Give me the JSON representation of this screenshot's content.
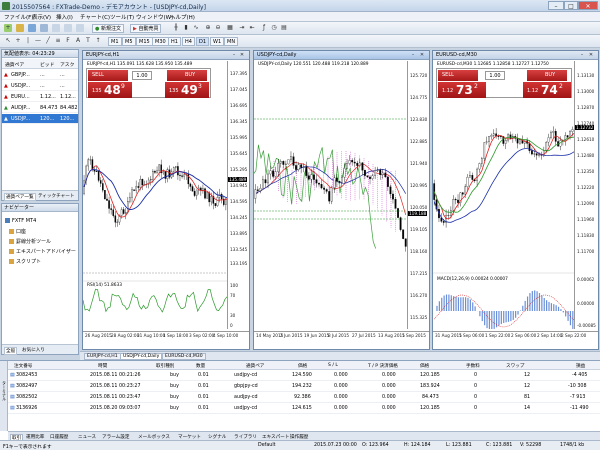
{
  "app": {
    "title": "2015507564 : FXTrade-Demo - デモアカウント - [USDJPY-cd,Daily]"
  },
  "window_controls": {
    "minimize": "–",
    "maximize": "□",
    "close": "✕"
  },
  "menu": [
    "ファイル(F)",
    "表示(V)",
    "挿入(I)",
    "チャート(C)",
    "ツール(T)",
    "ウィンドウ(W)",
    "ヘルプ(H)"
  ],
  "toolbar": {
    "new_order": "新規注文",
    "auto_trade": "自動売買",
    "periods": [
      "M1",
      "M5",
      "M15",
      "M30",
      "H1",
      "H4",
      "D1",
      "W1",
      "MN"
    ]
  },
  "market_watch": {
    "title": "気配値表示: 04:23:29",
    "headers": [
      "通貨ペア",
      "ビッド",
      "アスク"
    ],
    "rows": [
      {
        "symbol": "GBPJP...",
        "bid": "...",
        "ask": "..."
      },
      {
        "symbol": "USDJP...",
        "bid": "...",
        "ask": "..."
      },
      {
        "symbol": "EURU...",
        "bid": "1.12...",
        "ask": "1.12..."
      },
      {
        "symbol": "AUDJP...",
        "bid": "84.473",
        "ask": "84.482"
      },
      {
        "symbol": "USDJP...",
        "bid": "120...",
        "ask": "120..."
      }
    ],
    "tabs": [
      "通貨ペア一覧",
      "ティックチャート"
    ]
  },
  "navigator": {
    "title": "ナビゲーター",
    "items": [
      "FXTF MT4",
      "口座",
      "罫線分析ツール",
      "エキスパートアドバイザー",
      "スクリプト"
    ],
    "tabs": [
      "全般",
      "お気に入り"
    ]
  },
  "charts": [
    {
      "window_title": "EURJPY-cd,H1",
      "info": "EURJPY-cd,H1  135.091 135.628 135.950 135.489",
      "sell_label": "SELL",
      "buy_label": "BUY",
      "lot": "1.00",
      "sell_price": {
        "pre": "135",
        "big": "48",
        "sup": "9"
      },
      "buy_price": {
        "pre": "135",
        "big": "49",
        "sup": "3"
      },
      "price_axis": [
        "137.395",
        "137.045",
        "136.695",
        "136.345",
        "135.995",
        "135.645",
        "135.295",
        "134.945",
        "134.595",
        "134.245",
        "133.895",
        "133.545",
        "133.195"
      ],
      "current_price": "135.489",
      "indicator": "RSI(14) 51.8633",
      "indicator_axis": [
        "100",
        "70",
        "30",
        "0"
      ],
      "dates": [
        "26 Aug 2015",
        "27 Aug 10:00",
        "28 Aug 02:00",
        "28 Aug 18:00",
        "31 Aug 10:00",
        "1 Sep 02:00",
        "1 Sep 18:00",
        "2 Sep 10:00",
        "3 Sep 02:00",
        "3 Sep 18:00",
        "4 Sep 10:00"
      ]
    },
    {
      "window_title": "USDJPY-cd,Daily",
      "info": "USDJPY-cd,Daily  120.551 120.488 119.218 120.889",
      "price_axis": [
        "125.720",
        "124.775",
        "123.830",
        "122.885",
        "121.940",
        "120.995",
        "120.050",
        "119.105",
        "118.160",
        "117.215",
        "116.270",
        "115.325"
      ],
      "current_price": "119.188",
      "dates": [
        "14 May 2015",
        "2 Jun 2015",
        "19 Jun 2015",
        "8 Jul 2015",
        "27 Jul 2015",
        "13 Aug 2015",
        "1 Sep 2015"
      ]
    },
    {
      "window_title": "EURUSD-cd,M30",
      "info": "EURUSD-cd,M30  1.12685 1.12858 1.12727 1.12750",
      "sell_label": "SELL",
      "buy_label": "BUY",
      "lot": "1.00",
      "sell_price": {
        "pre": "1.12",
        "big": "73",
        "sup": "2"
      },
      "buy_price": {
        "pre": "1.12",
        "big": "74",
        "sup": "2"
      },
      "price_axis": [
        "1.13130",
        "1.13000",
        "1.12870",
        "1.12740",
        "1.12610",
        "1.12480",
        "1.12350",
        "1.12220",
        "1.12090",
        "1.11960",
        "1.11830",
        "1.11700"
      ],
      "current_price": "1.12732",
      "indicator": "MACD(12,26,9) 0.00024 0.00007",
      "indicator_axis": [
        "0.00062",
        "0.00000",
        "-0.00085"
      ],
      "dates": [
        "31 Aug 2015",
        "1 Sep 06:00",
        "1 Sep 14:00",
        "1 Sep 22:00",
        "2 Sep 06:00",
        "2 Sep 14:00",
        "2 Sep 22:00",
        "3 Sep 06:00"
      ]
    }
  ],
  "chart_tabs": [
    "EURJPY-cd,H1",
    "USDJPY-cd,Daily",
    "EURUSD-cd,M30"
  ],
  "terminal": {
    "headers": [
      "注文番号",
      "時間",
      "取引種別",
      "数量",
      "通貨ペア",
      "価格",
      "S / L",
      "T / P 決済価格",
      "価格",
      "手数料",
      "スワップ",
      "損益"
    ],
    "rows": [
      {
        "ticket": "3082453",
        "time": "2015.08.11 00:21:26",
        "type": "buy",
        "size": "0.01",
        "symbol": "usdjpy-cd",
        "price": "124.590",
        "sl": "0.000",
        "tp": "0.000",
        "cur": "120.185",
        "comm": "0",
        "swap": "12",
        "profit": "-4 405"
      },
      {
        "ticket": "3082497",
        "time": "2015.08.11 00:23:27",
        "type": "buy",
        "size": "0.01",
        "symbol": "gbpjpy-cd",
        "price": "194.232",
        "sl": "0.000",
        "tp": "0.000",
        "cur": "183.924",
        "comm": "0",
        "swap": "12",
        "profit": "-10 308"
      },
      {
        "ticket": "3082502",
        "time": "2015.08.11 00:23:47",
        "type": "buy",
        "size": "0.01",
        "symbol": "audjpy-cd",
        "price": "92.386",
        "sl": "0.000",
        "tp": "0.000",
        "cur": "84.473",
        "comm": "0",
        "swap": "81",
        "profit": "-7 913"
      },
      {
        "ticket": "3136926",
        "time": "2015.08.20 09:03:07",
        "type": "buy",
        "size": "0.01",
        "symbol": "usdjpy-cd",
        "price": "124.615",
        "sl": "0.000",
        "tp": "0.000",
        "cur": "120.185",
        "comm": "0",
        "swap": "14",
        "profit": "-11 490"
      }
    ],
    "tabs": [
      "取引",
      "運用比率",
      "口座履歴",
      "ニュース",
      "アラーム設定",
      "メールボックス",
      "マーケット",
      "シグナル",
      "ライブラリ",
      "エキスパート",
      "操作履歴"
    ],
    "side_label": "ターミナル"
  },
  "status": {
    "help": "F1キーで表示されます",
    "profile": "Default",
    "datetime": "2015.07.23 00:00",
    "open": "O: 123.964",
    "high": "H: 124.184",
    "low": "L: 123.881",
    "close": "C: 123.881",
    "volume": "V: 52298",
    "traffic": "1748/1 kb"
  }
}
